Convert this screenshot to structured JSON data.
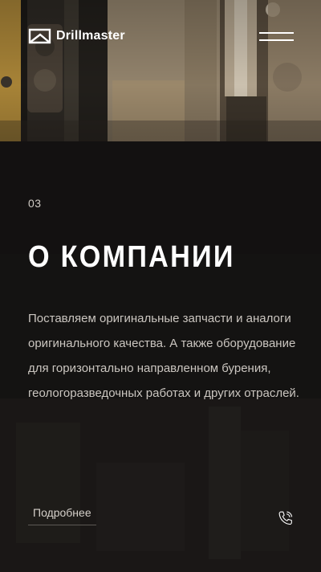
{
  "header": {
    "logo_text": "Drillmaster",
    "logo_icon": "envelope-arrow-logo-icon",
    "menu_icon": "hamburger-menu-icon"
  },
  "section": {
    "number": "03",
    "title": "О КОМПАНИИ",
    "description": "Поставляем оригинальные запчасти и аналоги оригинального качества. А также оборудование для горизонтально направленном бурения, геологоразведочных работах и других отраслей.",
    "more_label": "Подробнее",
    "phone_icon": "phone-call-icon"
  },
  "colors": {
    "background": "#141312",
    "text_primary": "#ffffff",
    "text_secondary": "#cbc6c0",
    "underline": "#5d5955"
  }
}
